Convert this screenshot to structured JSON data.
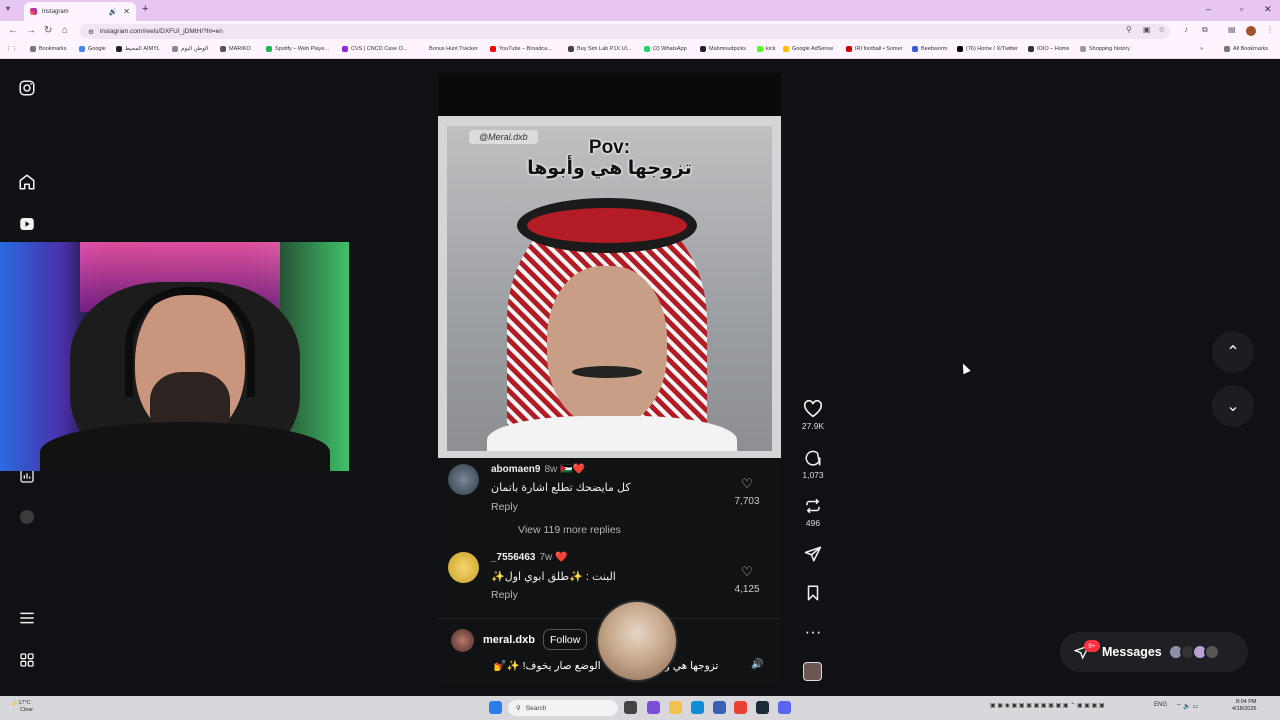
{
  "browser": {
    "tab_title": "Instagram",
    "url": "instagram.com/reels/DXFUI_jDMtH/?hl=en",
    "bookmarks": [
      "Bookmarks",
      "Google",
      "المحيط AIMYL",
      "الوطن اليوم",
      "MARIKO",
      "Spotify – Web Playe...",
      "CVS | CNCD Case O...",
      "Bonus Hunt Tracker",
      "YouTube – Broadca...",
      "Buy Sim Lab P1X Ul...",
      "(2) WhatsApp",
      "Mahmoudpicks",
      "kick",
      "Google AdSense",
      "IRI football • Somer",
      "Beebworm",
      "(76) Home / X/Twitter",
      "IOIO – Home",
      "Shopping history"
    ],
    "all_bookmarks": "All Bookmarks"
  },
  "reel": {
    "handle": "@Meral.dxb",
    "overlay_line1": "Pov:",
    "overlay_line2": "تزوجها هي وأبوها"
  },
  "comments": [
    {
      "user": "abomaen9",
      "time": "8w",
      "badge": "🇯🇴❤️",
      "text": "كل مايضحك تطلع اشارة باتمان",
      "reply": "Reply",
      "likes": "7,703"
    },
    {
      "user": "_7556463",
      "time": "7w",
      "badge": "❤️",
      "text": "البنت : ✨طلق ابوي اول✨",
      "reply": "Reply",
      "likes": "4,125"
    }
  ],
  "view_more": "View 119 more replies",
  "owner": {
    "name": "meral.dxb",
    "follow": "Follow",
    "caption": "تزوجها هي وأبوها 😂💀💔 الوضع صار يخوف! ✨💅"
  },
  "actions": {
    "likes": "27.9K",
    "comments": "1,073",
    "reposts": "496"
  },
  "messages": {
    "label": "Messages",
    "badge": "9+"
  },
  "taskbar": {
    "temp": "17°C",
    "condition": "Clear",
    "search": "Search",
    "lang": "ENG",
    "time": "8:04 PM",
    "date": "4/18/2026"
  }
}
